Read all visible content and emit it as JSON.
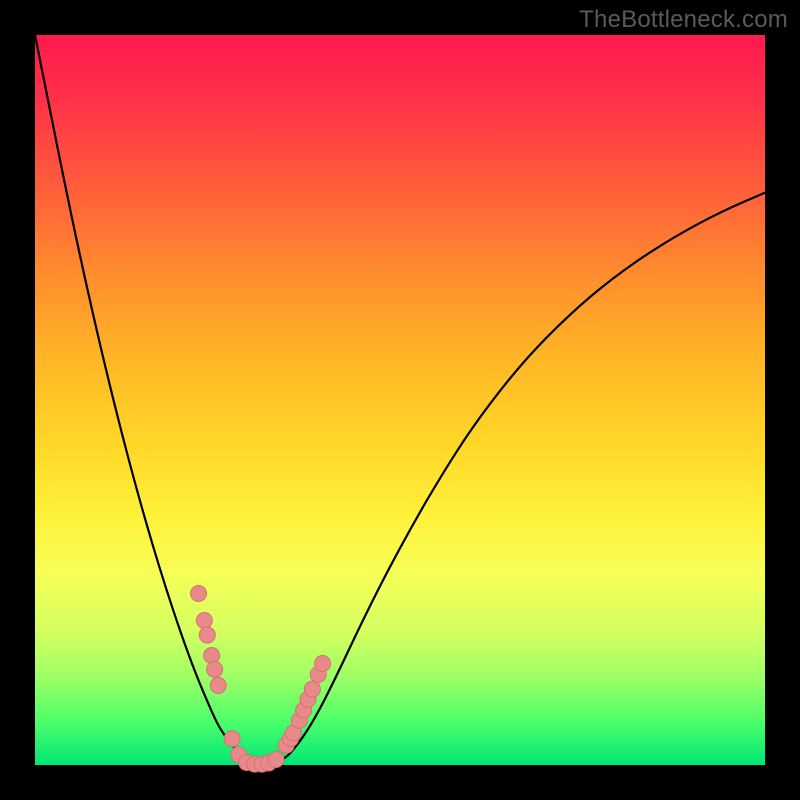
{
  "watermark": "TheBottleneck.com",
  "colors": {
    "frame": "#000000",
    "curve": "#000000",
    "marker_fill": "#e98a8a",
    "marker_stroke": "#d47171",
    "gradient_top": "#ff1a4d",
    "gradient_bottom": "#00e676"
  },
  "chart_data": {
    "type": "line",
    "title": "",
    "xlabel": "",
    "ylabel": "",
    "xlim": [
      0,
      100
    ],
    "ylim": [
      0,
      100
    ],
    "x": [
      0,
      2,
      4,
      6,
      8,
      10,
      12,
      14,
      16,
      18,
      20,
      22,
      24,
      25,
      26,
      27,
      28,
      29,
      30,
      31,
      32,
      33,
      34,
      35,
      37,
      39,
      41,
      43,
      45,
      48,
      52,
      56,
      60,
      65,
      70,
      76,
      82,
      88,
      94,
      100
    ],
    "y": [
      100,
      90,
      80,
      70.5,
      61.5,
      53,
      45,
      37.5,
      30.5,
      24,
      18,
      12.5,
      7.8,
      5.6,
      4,
      2.7,
      1.7,
      0.9,
      0.4,
      0.15,
      0.1,
      0.3,
      0.8,
      1.6,
      4.2,
      7.6,
      11.6,
      15.8,
      20,
      26,
      33.4,
      40.2,
      46.4,
      53,
      58.6,
      64.2,
      68.8,
      72.6,
      75.8,
      78.4
    ],
    "markers": {
      "x": [
        22.4,
        23.2,
        23.6,
        24.2,
        24.6,
        25.1,
        27.0,
        27.9,
        29.0,
        30.1,
        31.1,
        32.0,
        33.0,
        34.4,
        35.0,
        35.4,
        36.2,
        36.8,
        37.4,
        38.0,
        38.8,
        39.4
      ],
      "y": [
        23.5,
        19.8,
        17.8,
        15.0,
        13.1,
        10.9,
        3.6,
        1.4,
        0.35,
        0.12,
        0.12,
        0.28,
        0.75,
        2.7,
        3.6,
        4.4,
        6.1,
        7.5,
        9.0,
        10.4,
        12.4,
        13.9
      ]
    }
  }
}
